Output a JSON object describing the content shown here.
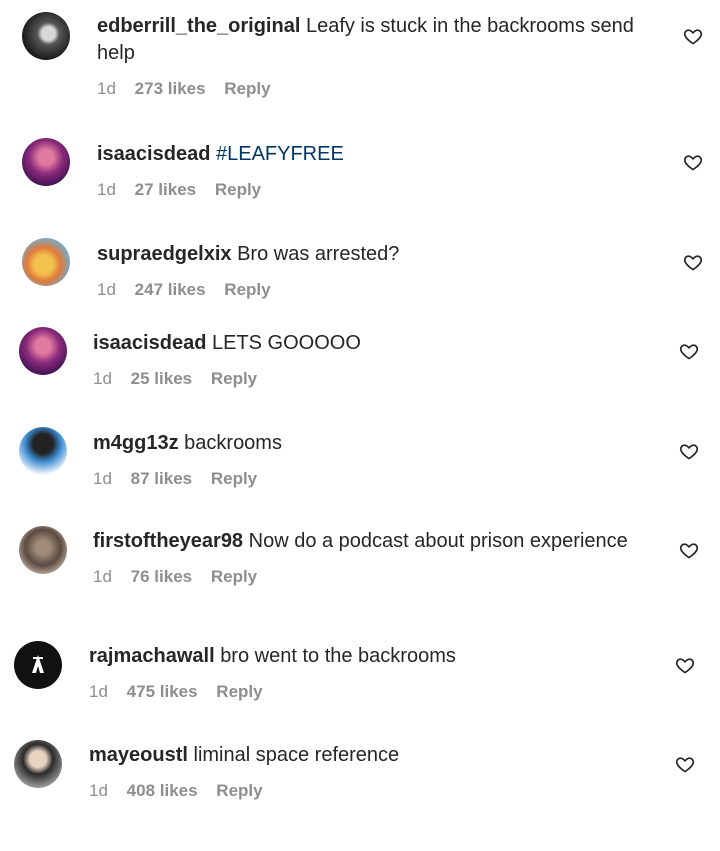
{
  "comments": [
    {
      "username": "edberrill_the_original",
      "text": "Leafy is stuck in the backrooms send help",
      "time": "1d",
      "likes": "273 likes",
      "reply": "Reply"
    },
    {
      "username": "isaacisdead",
      "text": "#LEAFYFREE",
      "time": "1d",
      "likes": "27 likes",
      "reply": "Reply"
    },
    {
      "username": "supraedgelxix",
      "text": "Bro was arrested?",
      "time": "1d",
      "likes": "247 likes",
      "reply": "Reply"
    },
    {
      "username": "isaacisdead",
      "text": "LETS GOOOOO",
      "time": "1d",
      "likes": "25 likes",
      "reply": "Reply"
    },
    {
      "username": "m4gg13z",
      "text": "backrooms",
      "time": "1d",
      "likes": "87 likes",
      "reply": "Reply"
    },
    {
      "username": "firstoftheyear98",
      "text": "Now do a podcast about prison experience",
      "time": "1d",
      "likes": "76 likes",
      "reply": "Reply"
    },
    {
      "username": "rajmachawall",
      "text": "bro went to the backrooms",
      "time": "1d",
      "likes": "475 likes",
      "reply": "Reply"
    },
    {
      "username": "mayeoustl",
      "text": "liminal space reference",
      "time": "1d",
      "likes": "408 likes",
      "reply": "Reply"
    }
  ],
  "icons": {
    "like": "heart-outline-icon",
    "avatar": "avatar"
  },
  "colors": {
    "text": "#262626",
    "meta": "#8e8e8e",
    "hashtag": "#00376b"
  }
}
